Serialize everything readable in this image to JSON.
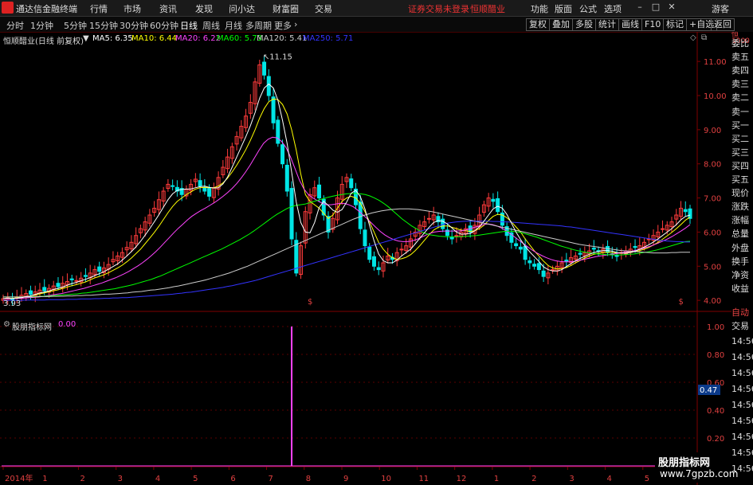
{
  "app": {
    "title": "通达信金融终端",
    "menu": [
      "行情",
      "市场",
      "资讯",
      "发现",
      "问小达",
      "财富圈",
      "交易"
    ],
    "notice": "证券交易未登录",
    "stock_name_red": "恒顺醋业",
    "right_menu": [
      "功能",
      "版面",
      "公式",
      "选项"
    ],
    "guest": "游客"
  },
  "toolbar": {
    "periods": [
      "分时",
      "1分钟",
      "5分钟",
      "15分钟",
      "30分钟",
      "60分钟",
      "日线",
      "周线",
      "月线",
      "多周期",
      "更多"
    ],
    "active": "日线",
    "right_buttons": [
      "复权",
      "叠加",
      "多股",
      "统计",
      "画线",
      "F10",
      "标记",
      "+自选",
      "返回"
    ]
  },
  "main_chart": {
    "title": "恒顺醋业(日线 前复权)",
    "ma": [
      {
        "label": "MA5: 6.35",
        "color": "#ffffff"
      },
      {
        "label": "MA10: 6.44",
        "color": "#ffff00"
      },
      {
        "label": "MA20: 6.22",
        "color": "#ff44ff"
      },
      {
        "label": "MA60: 5.73",
        "color": "#00ff00"
      },
      {
        "label": "MA120: 5.41",
        "color": "#cccccc"
      },
      {
        "label": "MA250: 5.71",
        "color": "#3333ff"
      }
    ],
    "y_ticks": [
      "11.00",
      "10.00",
      "9.00",
      "8.00",
      "7.00",
      "6.00",
      "5.00",
      "4.00"
    ],
    "high_label": "11.15",
    "low_label": "3.93"
  },
  "indicator": {
    "title": "股朋指标网",
    "value": "0.00",
    "y_ticks": [
      "1.00",
      "0.80",
      "0.60",
      "0.40",
      "0.20"
    ],
    "current_label": "0.47"
  },
  "x_axis": {
    "labels": [
      "2014年",
      "1",
      "2",
      "3",
      "4",
      "5",
      "6",
      "7",
      "8",
      "9",
      "10",
      "11",
      "12",
      "1",
      "2",
      "3",
      "4",
      "5",
      "6"
    ]
  },
  "sidebar": {
    "top": [
      "委比",
      "卖五",
      "卖四",
      "卖三",
      "卖二",
      "卖一",
      "买一",
      "买二",
      "买三",
      "买四",
      "买五",
      "现价",
      "涨跌",
      "涨幅",
      "总量",
      "外盘",
      "换手",
      "净资",
      "收益"
    ],
    "auto": "自动",
    "trade": "交易",
    "times": [
      "14:56",
      "14:56",
      "14:56",
      "14:56",
      "14:56",
      "14:56",
      "14:56",
      "14:56",
      "14:56"
    ]
  },
  "watermark": {
    "line1": "股朋指标网",
    "line2": "www.7gpzb.com"
  },
  "price_series": [
    4.05,
    4.08,
    4.02,
    4.1,
    4.15,
    4.2,
    4.18,
    4.25,
    4.3,
    4.28,
    4.35,
    4.42,
    4.4,
    4.5,
    4.55,
    4.6,
    4.58,
    4.65,
    4.7,
    4.8,
    4.9,
    4.85,
    4.95,
    5.05,
    5.2,
    5.3,
    5.4,
    5.55,
    5.7,
    5.9,
    6.1,
    6.3,
    6.5,
    6.7,
    6.95,
    7.2,
    7.4,
    7.35,
    7.2,
    7.1,
    7.25,
    7.4,
    7.55,
    7.35,
    7.2,
    7.05,
    7.3,
    7.6,
    7.9,
    8.2,
    8.5,
    8.8,
    9.1,
    9.4,
    9.8,
    10.4,
    10.9,
    10.6,
    10.0,
    9.2,
    8.6,
    8.0,
    7.2,
    5.8,
    4.8,
    5.6,
    6.6,
    7.1,
    7.3,
    7.0,
    6.5,
    6.0,
    6.4,
    7.0,
    7.4,
    7.6,
    7.3,
    6.8,
    6.1,
    5.6,
    5.2,
    5.0,
    4.9,
    5.1,
    5.3,
    5.2,
    5.4,
    5.5,
    5.6,
    5.8,
    6.0,
    6.2,
    6.3,
    6.4,
    6.5,
    6.3,
    6.1,
    5.9,
    5.8,
    5.9,
    6.0,
    6.1,
    6.0,
    6.2,
    6.5,
    6.8,
    7.0,
    6.9,
    6.6,
    6.2,
    5.9,
    5.7,
    5.6,
    5.5,
    5.2,
    5.1,
    5.0,
    4.9,
    4.7,
    4.8,
    4.9,
    5.0,
    5.1,
    5.15,
    5.25,
    5.3,
    5.35,
    5.4,
    5.45,
    5.5,
    5.45,
    5.5,
    5.4,
    5.35,
    5.3,
    5.4,
    5.45,
    5.5,
    5.55,
    5.6,
    5.7,
    5.8,
    5.9,
    6.0,
    6.1,
    6.2,
    6.3,
    6.5,
    6.7,
    6.6,
    6.4
  ],
  "ma_series": {
    "ma10": [
      4.05,
      4.06,
      4.06,
      4.07,
      4.09,
      4.11,
      4.13,
      4.16,
      4.19,
      4.22,
      4.25,
      4.28,
      4.31,
      4.35,
      4.39,
      4.43,
      4.46,
      4.5,
      4.54,
      4.6,
      4.66,
      4.7,
      4.75,
      4.81,
      4.88,
      4.95,
      5.03,
      5.13,
      5.24,
      5.37,
      5.5,
      5.66,
      5.82,
      5.99,
      6.17,
      6.37,
      6.57,
      6.75,
      6.9,
      7.0,
      7.1,
      7.18,
      7.26,
      7.3,
      7.31,
      7.3,
      7.3,
      7.35,
      7.44,
      7.58,
      7.76,
      7.96,
      8.18,
      8.42,
      8.69,
      9.0,
      9.34,
      9.62,
      9.82,
      9.9,
      9.88,
      9.74,
      9.46,
      9.0,
      8.4,
      7.7,
      7.1,
      6.9,
      6.8,
      6.7,
      6.55,
      6.4,
      6.5,
      6.7,
      6.9,
      7.0,
      7.05,
      7.0,
      6.85,
      6.6,
      6.3,
      6.0,
      5.7,
      5.5,
      5.35,
      5.25,
      5.2,
      5.22,
      5.26,
      5.34,
      5.46,
      5.6,
      5.76,
      5.92,
      6.06,
      6.14,
      6.18,
      6.18,
      6.14,
      6.1,
      6.06,
      6.04,
      6.02,
      6.04,
      6.1,
      6.2,
      6.34,
      6.46,
      6.52,
      6.5,
      6.42,
      6.3,
      6.15,
      6.0,
      5.8,
      5.62,
      5.45,
      5.3,
      5.15,
      5.02,
      4.95,
      4.92,
      4.93,
      4.96,
      5.02,
      5.1,
      5.17,
      5.24,
      5.3,
      5.35,
      5.38,
      5.4,
      5.41,
      5.4,
      5.39,
      5.39,
      5.4,
      5.41,
      5.43,
      5.46,
      5.5,
      5.55,
      5.62,
      5.7,
      5.79,
      5.89,
      5.99,
      6.1,
      6.22,
      6.35,
      6.44
    ],
    "ma20": [
      4.05,
      4.05,
      4.05,
      4.06,
      4.06,
      4.07,
      4.08,
      4.09,
      4.1,
      4.12,
      4.14,
      4.16,
      4.18,
      4.2,
      4.23,
      4.26,
      4.29,
      4.32,
      4.35,
      4.39,
      4.43,
      4.47,
      4.51,
      4.56,
      4.61,
      4.66,
      4.72,
      4.78,
      4.85,
      4.93,
      5.01,
      5.1,
      5.2,
      5.31,
      5.43,
      5.56,
      5.7,
      5.84,
      5.98,
      6.11,
      6.23,
      6.35,
      6.46,
      6.55,
      6.63,
      6.7,
      6.78,
      6.86,
      6.95,
      7.05,
      7.16,
      7.28,
      7.42,
      7.58,
      7.76,
      7.96,
      8.18,
      8.4,
      8.6,
      8.72,
      8.78,
      8.76,
      8.66,
      8.48,
      8.2,
      7.86,
      7.52,
      7.26,
      7.1,
      7.0,
      6.92,
      6.85,
      6.8,
      6.8,
      6.82,
      6.84,
      6.84,
      6.8,
      6.74,
      6.64,
      6.52,
      6.4,
      6.27,
      6.14,
      6.02,
      5.92,
      5.84,
      5.78,
      5.74,
      5.72,
      5.72,
      5.74,
      5.78,
      5.84,
      5.9,
      5.96,
      6.0,
      6.02,
      6.03,
      6.03,
      6.03,
      6.03,
      6.04,
      6.06,
      6.1,
      6.14,
      6.18,
      6.22,
      6.24,
      6.22,
      6.18,
      6.12,
      6.04,
      5.95,
      5.85,
      5.75,
      5.65,
      5.55,
      5.46,
      5.38,
      5.31,
      5.25,
      5.2,
      5.16,
      5.14,
      5.13,
      5.13,
      5.14,
      5.16,
      5.19,
      5.22,
      5.25,
      5.28,
      5.3,
      5.32,
      5.34,
      5.36,
      5.38,
      5.4,
      5.42,
      5.44,
      5.47,
      5.5,
      5.54,
      5.58,
      5.63,
      5.68,
      5.74,
      5.8,
      5.87,
      5.95,
      6.03,
      6.12,
      6.22
    ],
    "ma60": [
      4.1,
      4.1,
      4.1,
      4.1,
      4.1,
      4.1,
      4.11,
      4.11,
      4.12,
      4.12,
      4.13,
      4.14,
      4.15,
      4.16,
      4.17,
      4.18,
      4.19,
      4.21,
      4.22,
      4.24,
      4.26,
      4.28,
      4.3,
      4.32,
      4.34,
      4.37,
      4.4,
      4.43,
      4.46,
      4.5,
      4.54,
      4.58,
      4.62,
      4.67,
      4.72,
      4.78,
      4.84,
      4.9,
      4.96,
      5.02,
      5.08,
      5.14,
      5.2,
      5.26,
      5.32,
      5.38,
      5.44,
      5.5,
      5.57,
      5.64,
      5.71,
      5.78,
      5.86,
      5.94,
      6.03,
      6.13,
      6.23,
      6.33,
      6.43,
      6.52,
      6.6,
      6.68,
      6.74,
      6.78,
      6.8,
      6.82,
      6.86,
      6.9,
      6.94,
      6.98,
      7.02,
      7.05,
      7.08,
      7.1,
      7.12,
      7.13,
      7.13,
      7.12,
      7.1,
      7.06,
      7.0,
      6.93,
      6.84,
      6.74,
      6.62,
      6.5,
      6.38,
      6.28,
      6.18,
      6.1,
      6.02,
      5.96,
      5.92,
      5.9,
      5.88,
      5.87,
      5.86,
      5.86,
      5.86,
      5.87,
      5.88,
      5.89,
      5.9,
      5.92,
      5.94,
      5.96,
      5.98,
      6.0,
      6.02,
      6.03,
      6.02,
      6.0,
      5.97,
      5.93,
      5.89,
      5.85,
      5.8,
      5.75,
      5.7,
      5.65,
      5.6,
      5.56,
      5.52,
      5.48,
      5.45,
      5.42,
      5.4,
      5.38,
      5.36,
      5.35,
      5.34,
      5.33,
      5.33,
      5.33,
      5.34,
      5.35,
      5.36,
      5.38,
      5.4,
      5.42,
      5.45,
      5.48,
      5.52,
      5.56,
      5.6,
      5.64,
      5.68,
      5.72,
      5.73
    ],
    "ma120": [
      4.1,
      4.1,
      4.1,
      4.1,
      4.1,
      4.1,
      4.1,
      4.1,
      4.11,
      4.11,
      4.11,
      4.12,
      4.12,
      4.12,
      4.13,
      4.13,
      4.14,
      4.14,
      4.15,
      4.15,
      4.16,
      4.17,
      4.18,
      4.18,
      4.19,
      4.2,
      4.21,
      4.22,
      4.24,
      4.25,
      4.26,
      4.28,
      4.3,
      4.31,
      4.33,
      4.35,
      4.37,
      4.4,
      4.42,
      4.45,
      4.48,
      4.51,
      4.54,
      4.57,
      4.6,
      4.64,
      4.68,
      4.72,
      4.76,
      4.8,
      4.85,
      4.9,
      4.95,
      5.0,
      5.06,
      5.12,
      5.18,
      5.24,
      5.3,
      5.36,
      5.42,
      5.48,
      5.54,
      5.6,
      5.66,
      5.72,
      5.78,
      5.84,
      5.9,
      5.96,
      6.02,
      6.08,
      6.14,
      6.2,
      6.26,
      6.32,
      6.38,
      6.43,
      6.48,
      6.52,
      6.56,
      6.59,
      6.62,
      6.64,
      6.66,
      6.67,
      6.68,
      6.68,
      6.68,
      6.67,
      6.66,
      6.64,
      6.62,
      6.6,
      6.57,
      6.54,
      6.51,
      6.48,
      6.45,
      6.42,
      6.39,
      6.36,
      6.33,
      6.3,
      6.27,
      6.24,
      6.21,
      6.18,
      6.15,
      6.12,
      6.09,
      6.06,
      6.03,
      6.0,
      5.97,
      5.94,
      5.91,
      5.88,
      5.85,
      5.82,
      5.79,
      5.76,
      5.73,
      5.7,
      5.67,
      5.64,
      5.62,
      5.6,
      5.58,
      5.56,
      5.54,
      5.52,
      5.5,
      5.48,
      5.46,
      5.45,
      5.44,
      5.43,
      5.42,
      5.41,
      5.4,
      5.39,
      5.39,
      5.39,
      5.39,
      5.4,
      5.4,
      5.41,
      5.41,
      5.41
    ],
    "ma250": [
      4.0,
      4.0,
      4.0,
      4.0,
      4.0,
      4.01,
      4.01,
      4.01,
      4.01,
      4.01,
      4.02,
      4.02,
      4.02,
      4.02,
      4.03,
      4.03,
      4.03,
      4.04,
      4.04,
      4.04,
      4.05,
      4.05,
      4.06,
      4.06,
      4.07,
      4.07,
      4.08,
      4.08,
      4.09,
      4.1,
      4.11,
      4.12,
      4.13,
      4.14,
      4.15,
      4.16,
      4.17,
      4.18,
      4.2,
      4.21,
      4.23,
      4.24,
      4.26,
      4.28,
      4.3,
      4.32,
      4.34,
      4.36,
      4.38,
      4.41,
      4.43,
      4.46,
      4.49,
      4.52,
      4.55,
      4.58,
      4.62,
      4.66,
      4.7,
      4.74,
      4.78,
      4.82,
      4.86,
      4.9,
      4.94,
      4.98,
      5.02,
      5.06,
      5.1,
      5.14,
      5.18,
      5.22,
      5.26,
      5.3,
      5.34,
      5.38,
      5.42,
      5.46,
      5.5,
      5.54,
      5.58,
      5.62,
      5.66,
      5.7,
      5.74,
      5.78,
      5.82,
      5.86,
      5.9,
      5.94,
      5.98,
      6.02,
      6.06,
      6.1,
      6.14,
      6.18,
      6.22,
      6.26,
      6.28,
      6.3,
      6.31,
      6.32,
      6.32,
      6.32,
      6.32,
      6.32,
      6.32,
      6.31,
      6.31,
      6.3,
      6.3,
      6.29,
      6.28,
      6.27,
      6.26,
      6.25,
      6.24,
      6.23,
      6.22,
      6.21,
      6.2,
      6.19,
      6.18,
      6.16,
      6.15,
      6.13,
      6.11,
      6.09,
      6.07,
      6.05,
      6.03,
      6.01,
      5.99,
      5.97,
      5.95,
      5.93,
      5.91,
      5.89,
      5.87,
      5.85,
      5.83,
      5.81,
      5.79,
      5.77,
      5.75,
      5.74,
      5.73,
      5.72,
      5.72,
      5.71,
      5.71
    ]
  },
  "spike_index": 63,
  "colors": {
    "up": "#ff3b3b",
    "down": "#00e5e5",
    "axis": "#800000",
    "grid": "#5a0000",
    "indicator_line": "#ff44ff"
  }
}
